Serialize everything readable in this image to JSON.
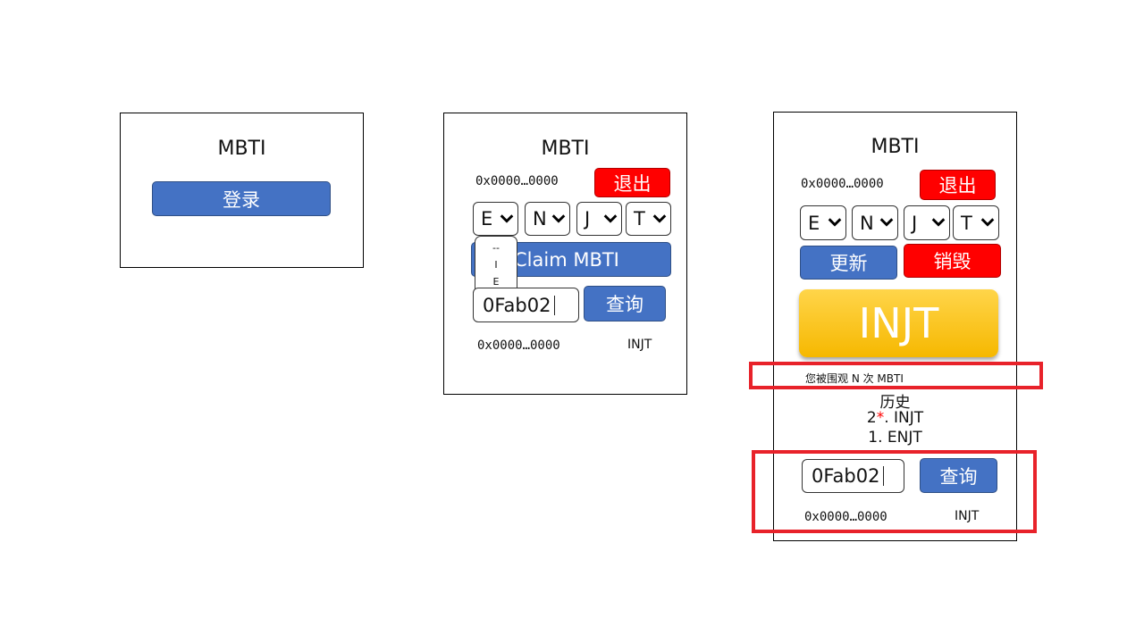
{
  "screen1": {
    "title": "MBTI",
    "login_label": "登录"
  },
  "screen2": {
    "title": "MBTI",
    "address": "0x0000…0000",
    "logout_label": "退出",
    "selects": [
      "E",
      "N",
      "J",
      "T"
    ],
    "dropdown_options": [
      "--",
      "I",
      "E"
    ],
    "claim_label": "Claim MBTI",
    "query_input_value": "0Fab02",
    "query_label": "查询",
    "result_address": "0x0000…0000",
    "result_type": "INJT"
  },
  "screen3": {
    "title": "MBTI",
    "address": "0x0000…0000",
    "logout_label": "退出",
    "selects": [
      "E",
      "N",
      "J",
      "T"
    ],
    "update_label": "更新",
    "destroy_label": "销毁",
    "mbti_result": "INJT",
    "watched_text": "您被围观 N 次 MBTI",
    "history_title": "历史",
    "history": [
      {
        "index": "2",
        "star": "*",
        "rest": ". INJT"
      },
      {
        "index": "1",
        "star": "",
        "rest": ".  ENJT"
      }
    ],
    "query_input_value": "0Fab02",
    "query_label": "查询",
    "result_address": "0x0000…0000",
    "result_type": "INJT"
  },
  "colors": {
    "primary": "#4472c4",
    "danger": "#ff0000",
    "highlight": "#e8222a",
    "gold": "#f6b800"
  }
}
